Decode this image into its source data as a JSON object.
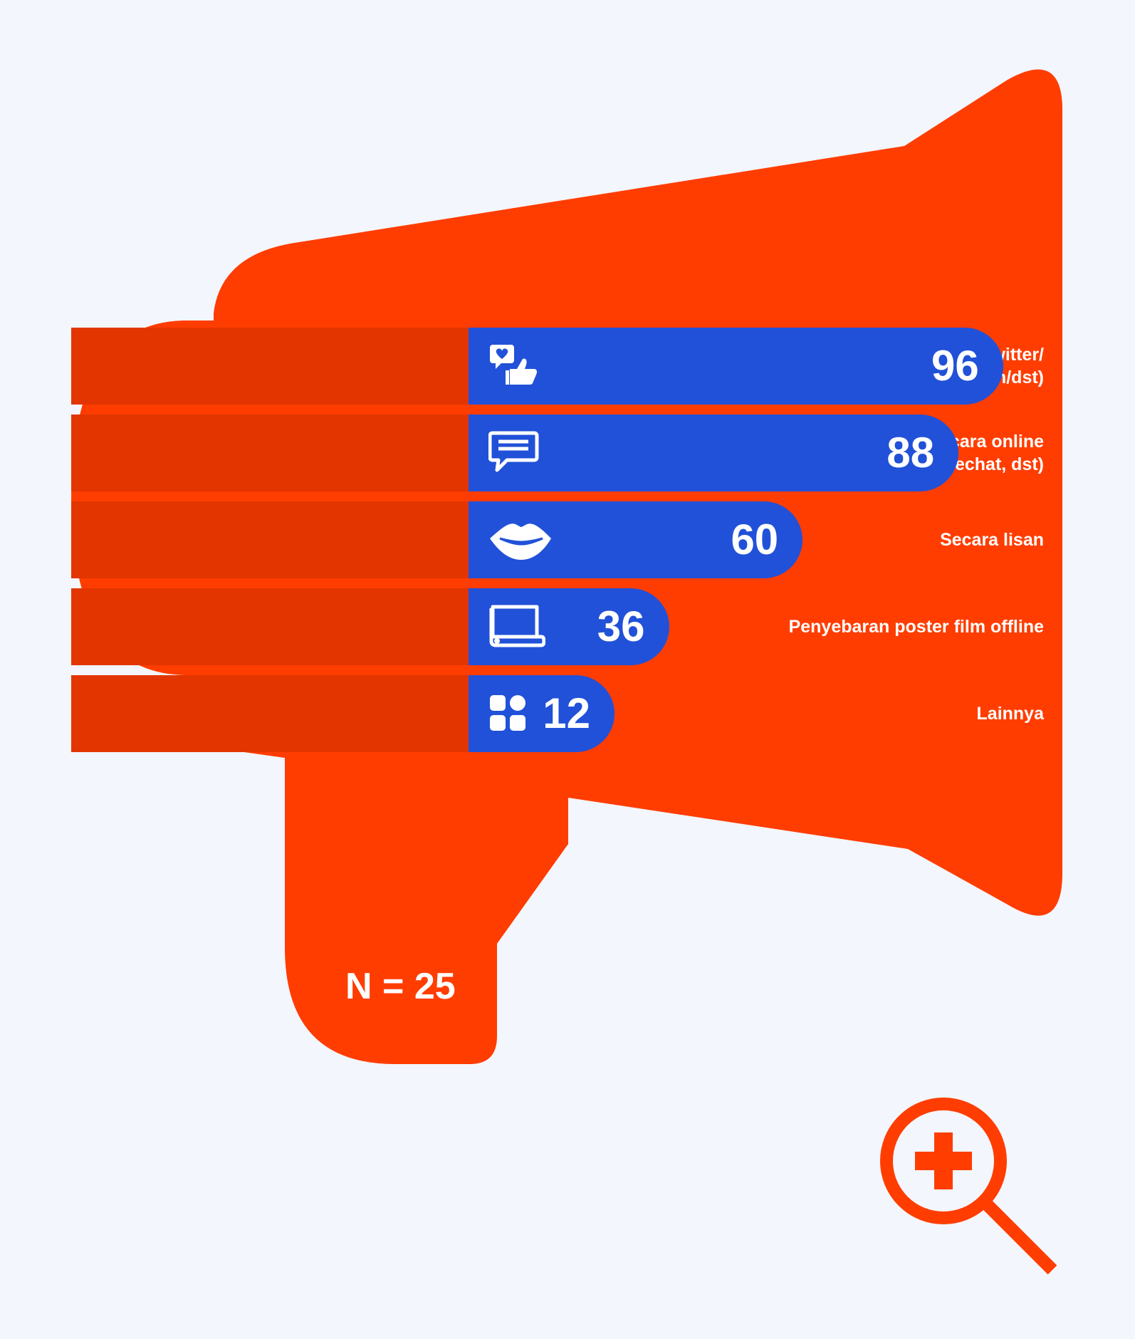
{
  "colors": {
    "background": "#f3f6fc",
    "megaphone": "#ff3d00",
    "label_band": "#e23500",
    "bar": "#2151d8",
    "text": "#ffffff"
  },
  "chart_data": {
    "type": "bar",
    "orientation": "horizontal",
    "categories": [
      "Media sosial (Twitter/\nFacebook/Path/dst)",
      "SMS/chat/group chat secara online\n(whatsapp, line, wechat, dst)",
      "Secara lisan",
      "Penyebaran poster film offline",
      "Lainnya"
    ],
    "values": [
      96,
      88,
      60,
      36,
      12
    ],
    "icons": [
      "social-like-icon",
      "chat-bubble-icon",
      "lips-icon",
      "poster-scroll-icon",
      "apps-grid-icon"
    ],
    "sample_size_label": "N = 25",
    "xlim": [
      0,
      100
    ]
  },
  "zoom_icon": "zoom-in-icon"
}
